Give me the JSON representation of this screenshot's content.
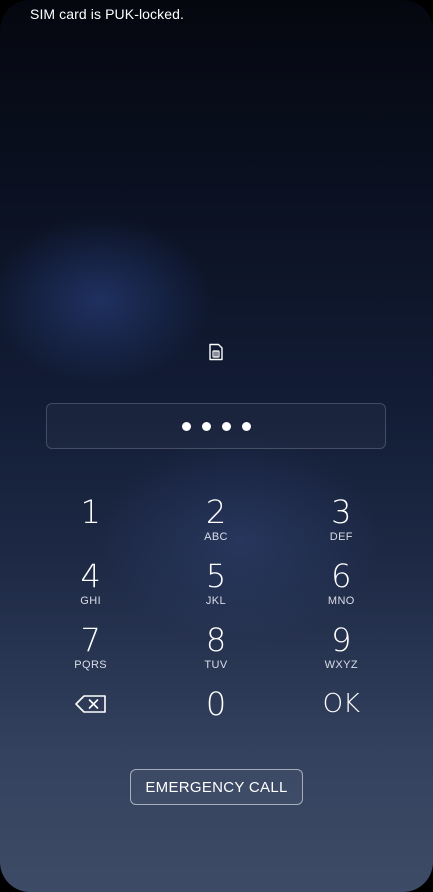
{
  "status": {
    "message": "SIM card is PUK-locked."
  },
  "pin": {
    "digits_entered": 4
  },
  "keypad": {
    "keys": [
      {
        "digit": "1",
        "letters": ""
      },
      {
        "digit": "2",
        "letters": "ABC"
      },
      {
        "digit": "3",
        "letters": "DEF"
      },
      {
        "digit": "4",
        "letters": "GHI"
      },
      {
        "digit": "5",
        "letters": "JKL"
      },
      {
        "digit": "6",
        "letters": "MNO"
      },
      {
        "digit": "7",
        "letters": "PQRS"
      },
      {
        "digit": "8",
        "letters": "TUV"
      },
      {
        "digit": "9",
        "letters": "WXYZ"
      }
    ],
    "zero": "0",
    "ok_label": "OK",
    "backspace_icon": "backspace-icon"
  },
  "emergency": {
    "label": "EMERGENCY CALL"
  },
  "icons": {
    "sim": "sim-card-icon"
  }
}
